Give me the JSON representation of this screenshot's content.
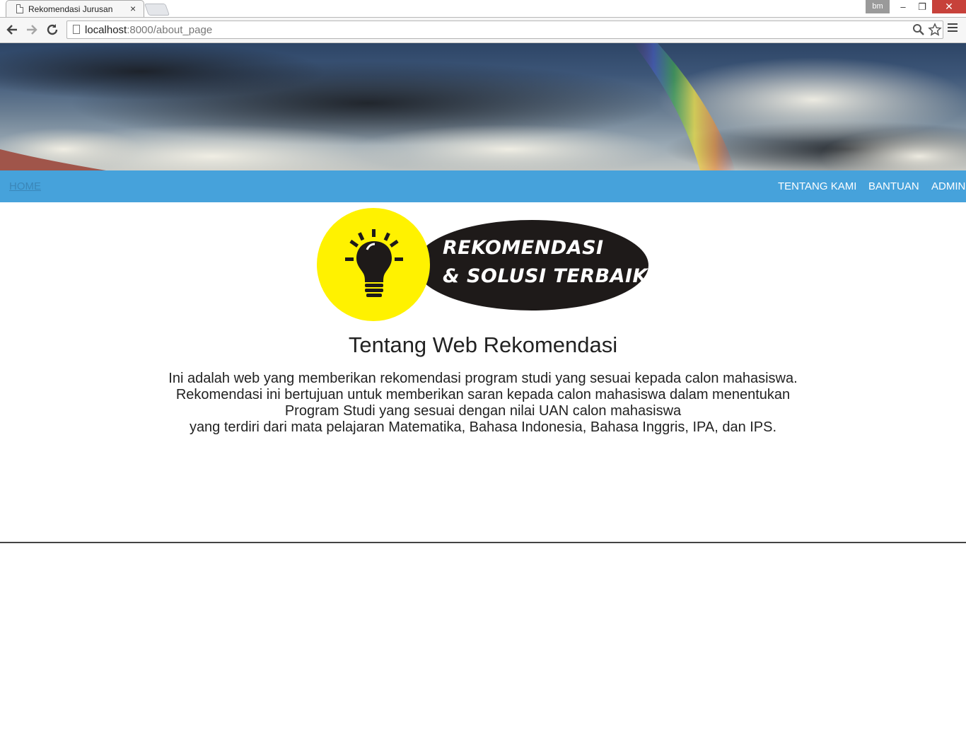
{
  "browser": {
    "tab_title": "Rekomendasi Jurusan",
    "tab_close": "×",
    "profile_label": "bm",
    "url_host": "localhost",
    "url_path": ":8000/about_page",
    "window": {
      "minimize": "–",
      "maximize": "❐",
      "close": "✕"
    }
  },
  "nav": {
    "home": "HOME",
    "items": [
      "TENTANG KAMI",
      "BANTUAN",
      "ADMIN"
    ]
  },
  "logo": {
    "line1": "REKOMENDASI",
    "line2": "& SOLUSI TERBAIK"
  },
  "main": {
    "heading": "Tentang Web Rekomendasi",
    "lines": [
      "Ini adalah web yang memberikan rekomendasi program studi yang sesuai kepada calon mahasiswa.",
      "Rekomendasi ini bertujuan untuk memberikan saran kepada calon mahasiswa dalam menentukan",
      "Program Studi yang sesuai dengan nilai UAN calon mahasiswa",
      "yang terdiri dari mata pelajaran Matematika, Bahasa Indonesia, Bahasa Inggris, IPA, dan IPS."
    ]
  },
  "colors": {
    "navbar": "#46a2db",
    "logo_circle": "#fff200",
    "logo_ellipse": "#1e1a19"
  }
}
